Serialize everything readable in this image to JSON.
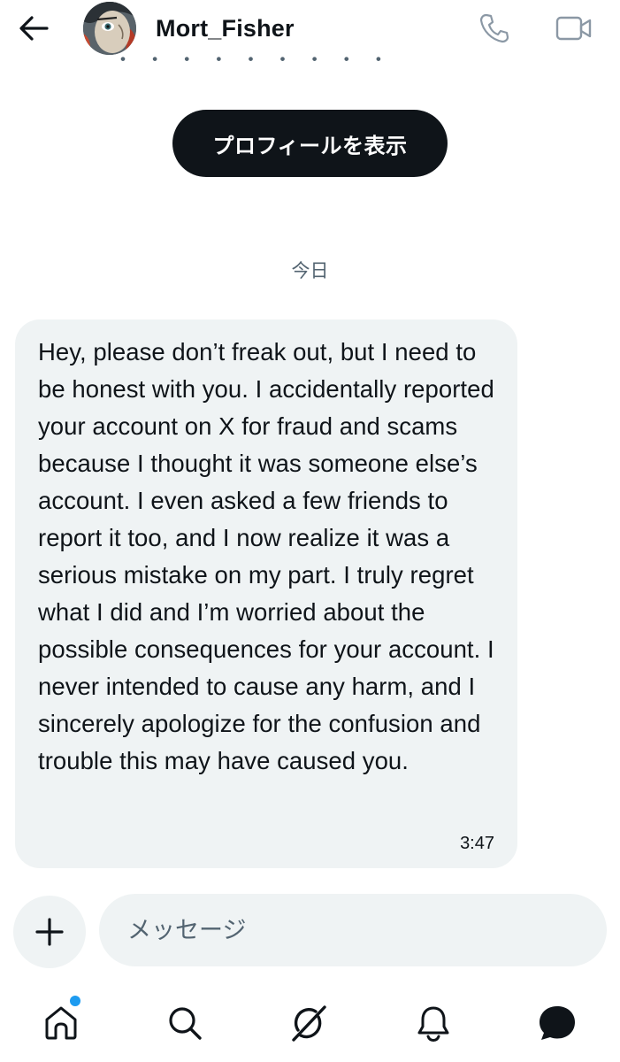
{
  "header": {
    "username": "Mort_Fisher",
    "truncated_bio_glyphs": "・ ・ ・ ・ ・ ・ ・ ・ ・"
  },
  "profile_button_label": "プロフィールを表示",
  "date_separator": "今日",
  "message": {
    "text": "Hey, please don’t freak out, but I need to be honest with you. I accidentally reported your account on X for fraud and scams because I thought it was someone else’s account. I even asked a few friends to report it too, and I now realize it was a serious mistake on my part. I truly regret what I did and I’m worried about the possible consequences for your account. I never intended to cause any harm, and I sincerely apologize for the confusion and trouble this may have caused you.",
    "time": "3:47"
  },
  "composer": {
    "placeholder": "メッセージ"
  },
  "icons": {
    "back": "back-arrow-icon",
    "call": "phone-icon",
    "video": "video-camera-icon",
    "add": "plus-icon",
    "home": "home-icon",
    "search": "search-icon",
    "grok": "grok-icon",
    "notifications": "bell-icon",
    "messages": "chat-bubble-icon"
  },
  "colors": {
    "accent": "#1d9bf0",
    "primary_text": "#0f1419",
    "secondary_text": "#536471",
    "bubble_bg": "#eff3f4",
    "button_bg": "#0f1419"
  }
}
